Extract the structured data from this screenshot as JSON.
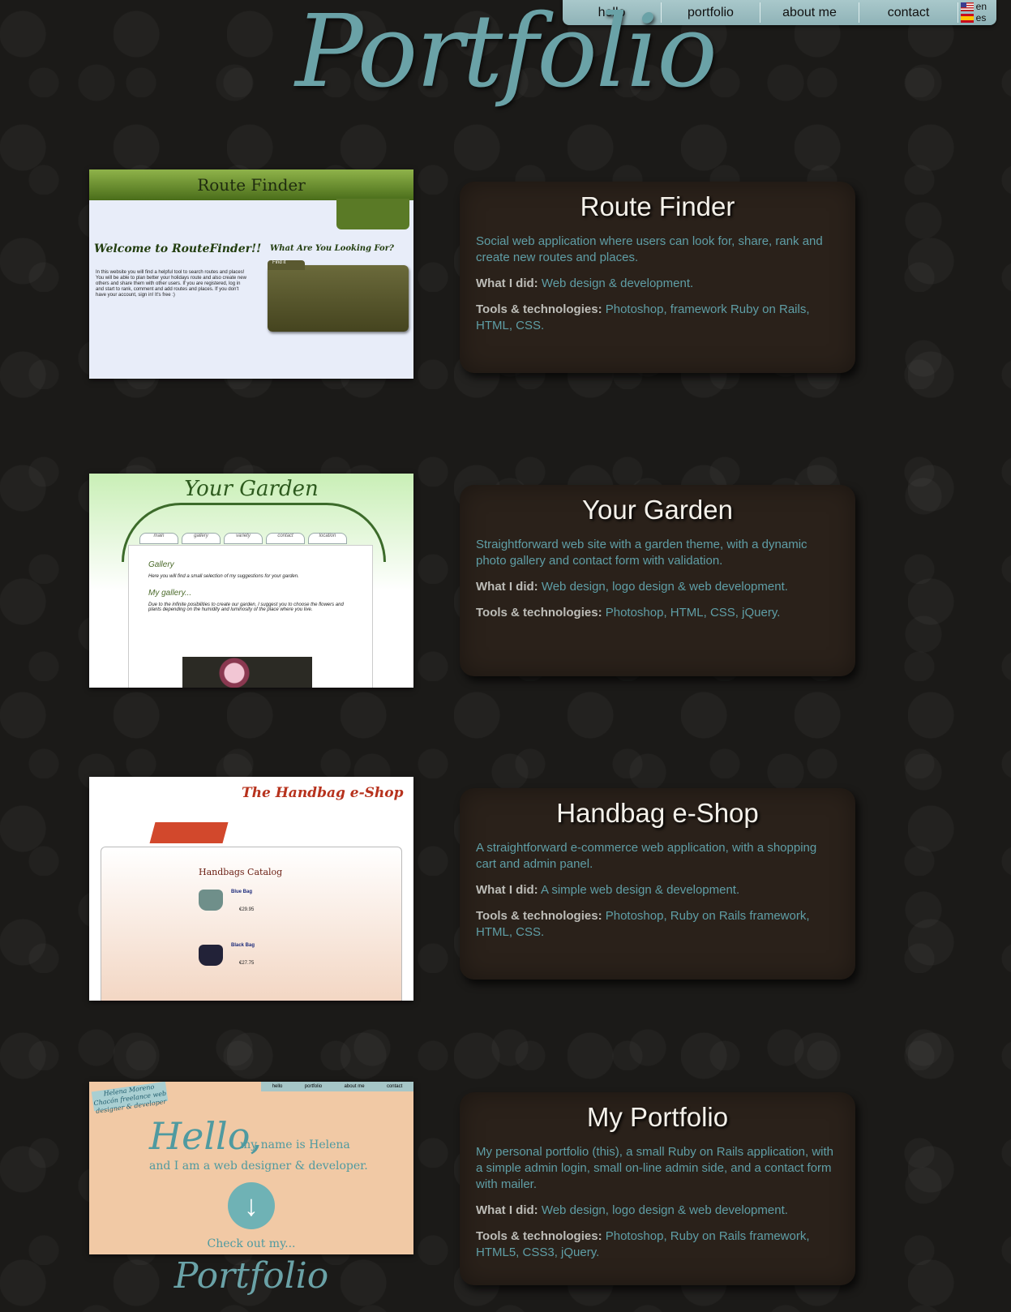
{
  "site": {
    "title": "Portfolio"
  },
  "nav": {
    "items": [
      "hello",
      "portfolio",
      "about me",
      "contact"
    ]
  },
  "languages": [
    "en",
    "es"
  ],
  "projects": [
    {
      "title": "Route Finder",
      "description": "Social web application where users can look for, share, rank and create new routes and places.",
      "what_label": "What I did:",
      "what": "Web design & development.",
      "tools_label": "Tools & technologies:",
      "tools": "Photoshop, framework Ruby on Rails, HTML, CSS.",
      "screenshot": {
        "header": "Route Finder",
        "welcome": "Welcome to RouteFinder!!",
        "looking": "What Are You Looking For?",
        "find_tab": "Find it",
        "intro": "In this website you will find a helpful tool to search routes and places! You will be able to plan better your holidays route and also create new others and share them with other users. If you are registered, log in and start to rank, comment and add routes and places. If you don't have your account, sign in! It's free :)"
      }
    },
    {
      "title": "Your Garden",
      "description": "Straightforward web site with a garden theme, with a dynamic photo gallery and contact form with validation.",
      "what_label": "What I did:",
      "what": "Web design, logo design & web development.",
      "tools_label": "Tools & technologies:",
      "tools": "Photoshop, HTML, CSS, jQuery.",
      "screenshot": {
        "logo": "Your Garden",
        "tabs": [
          "main",
          "gallery",
          "variety",
          "contact",
          "location"
        ],
        "heading": "Gallery",
        "text": "Here you will find a small selection of my suggestions for your garden.",
        "subheading": "My gallery...",
        "text2": "Due to the infinite posibilities to create our garden, I suggest you to choose the flowers and plants depending on the humidity and luminosity of the place where you live."
      }
    },
    {
      "title": "Handbag e-Shop",
      "description": "A straightforward e-commerce web application, with a shopping cart and admin panel.",
      "what_label": "What I did:",
      "what": "A simple web design & development.",
      "tools_label": "Tools & technologies:",
      "tools": "Photoshop, Ruby on Rails framework, HTML, CSS.",
      "screenshot": {
        "title": "The Handbag e-Shop",
        "catalog": "Handbags Catalog",
        "item1": "Blue Bag",
        "item1_price": "€29.95",
        "item2": "Black Bag",
        "item2_price": "€27.75"
      }
    },
    {
      "title": "My Portfolio",
      "description": "My personal portfolio (this), a small Ruby on Rails application, with a simple admin login, small on-line admin side, and a contact form with mailer.",
      "what_label": "What I did:",
      "what": "Web design, logo design & web development.",
      "tools_label": "Tools & technologies:",
      "tools": "Photoshop, Ruby on Rails framework, HTML5, CSS3, jQuery.",
      "screenshot": {
        "sign": "Helena Moreno Chacón freelance web designer & developer",
        "hello": "Hello,",
        "name": "my name is Helena",
        "role": "and I am a web designer & developer.",
        "check": "Check out my...",
        "script": "Portfolio",
        "menu": [
          "hello",
          "portfolio",
          "about me",
          "contact"
        ]
      }
    }
  ]
}
